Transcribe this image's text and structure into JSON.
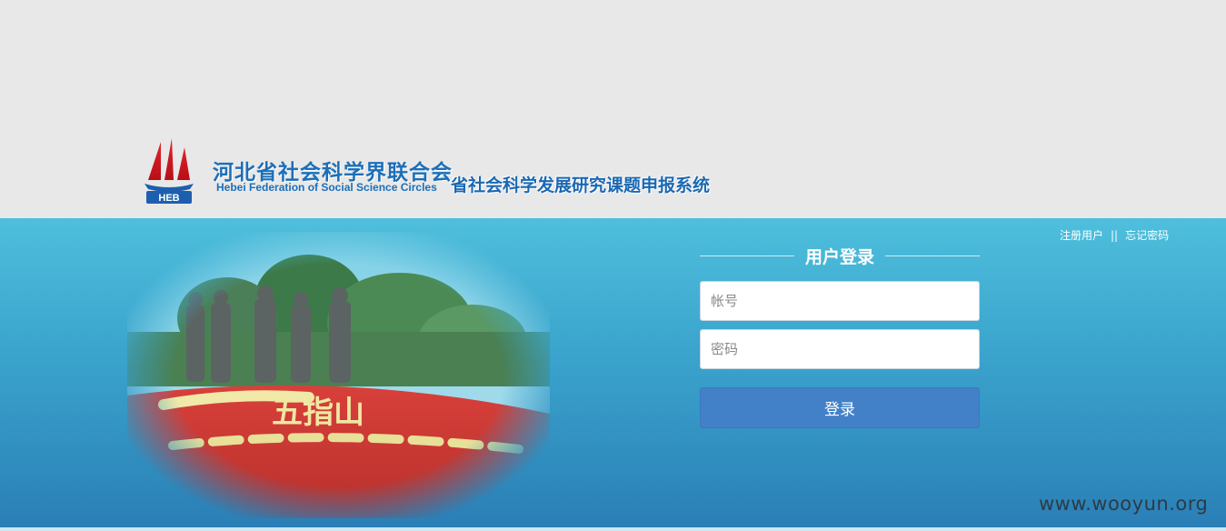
{
  "header": {
    "org_name_cn": "河北省社会科学界联合会",
    "org_name_en": "Hebei Federation of Social Science Circles",
    "logo_text": "HEB",
    "system_name": "省社会科学发展研究课题申报系统"
  },
  "top_links": {
    "register": "注册用户",
    "separator": "||",
    "forgot": "忘记密码"
  },
  "login": {
    "title": "用户登录",
    "account_placeholder": "帐号",
    "password_placeholder": "密码",
    "submit_label": "登录"
  },
  "photo": {
    "flowerbed_text": "五指山"
  },
  "watermark": "www.wooyun.org",
  "colors": {
    "band_top": "#4ebfdc",
    "band_bottom": "#2a7fb6",
    "button": "#4281c8",
    "brand_blue": "#1c6fb8"
  }
}
